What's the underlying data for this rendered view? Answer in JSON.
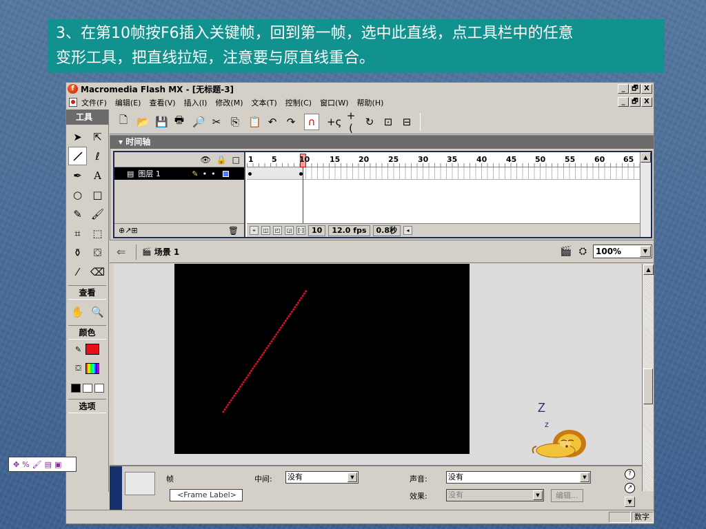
{
  "instruction": {
    "line1": "3、在第10帧按F6插入关键帧，回到第一帧，选中此直线，点工具栏中的任意",
    "line2": "变形工具，把直线拉短，注意要与原直线重合。"
  },
  "window": {
    "title": "Macromedia Flash MX - [无标题-3]",
    "logo_letter": "f",
    "controls": [
      "_",
      "🗗",
      "X"
    ]
  },
  "menu": {
    "items": [
      "文件(F)",
      "编辑(E)",
      "查看(V)",
      "插入(I)",
      "修改(M)",
      "文本(T)",
      "控制(C)",
      "窗口(W)",
      "帮助(H)"
    ]
  },
  "tools": {
    "title": "工具",
    "view_label": "查看",
    "colors_label": "颜色",
    "options_label": "选项",
    "stroke_color": "#e8101a",
    "fill_color": "rainbow"
  },
  "timeline": {
    "title": "时间轴",
    "ruler_labels": [
      "1",
      "5",
      "10",
      "15",
      "20",
      "25",
      "30",
      "35",
      "40",
      "45",
      "50",
      "55",
      "60",
      "65"
    ],
    "layer_name": "图层 1",
    "current_frame": "10",
    "fps": "12.0 fps",
    "time": "0.8秒"
  },
  "scene": {
    "name": "场景 1",
    "zoom": "100%"
  },
  "stage": {
    "background": "#000000",
    "line_color": "#e01030"
  },
  "properties": {
    "frame_label_title": "帧",
    "frame_label_placeholder": "<Frame Label>",
    "tween_label": "中间:",
    "tween_value": "没有",
    "sound_label": "声音:",
    "sound_value": "没有",
    "effect_label": "效果:",
    "effect_value": "没有",
    "edit_button": "编辑..."
  },
  "status": {
    "mode": "数字"
  },
  "mascot": {
    "sleep_text_1": "Z",
    "sleep_text_2": "z"
  }
}
